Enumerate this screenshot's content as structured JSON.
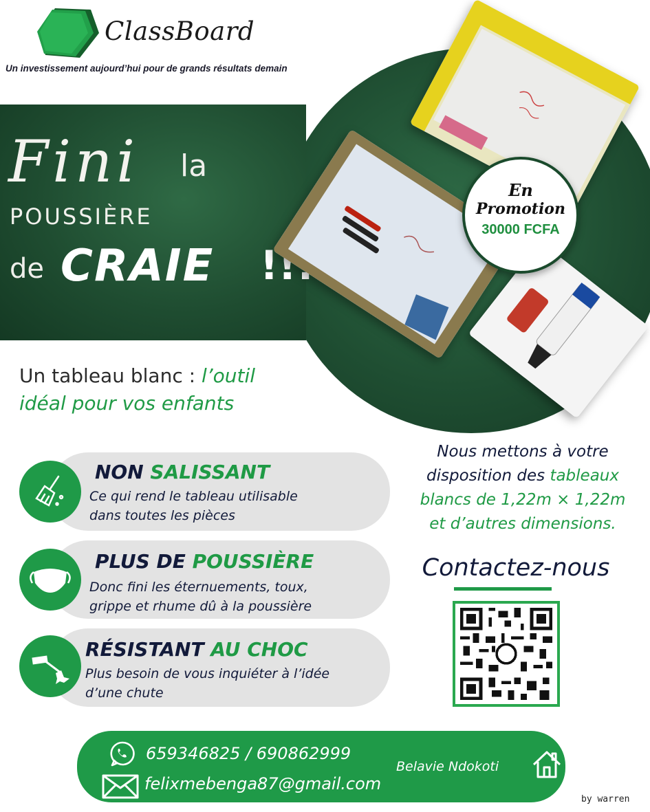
{
  "brand": {
    "name": "ClassBoard",
    "tagline": "Un investissement aujourd’hui pour de grands résultats demain",
    "color_green": "#1f9a48",
    "color_dark_green": "#1f4e32"
  },
  "headline": {
    "fini": "Fini",
    "la": "la",
    "poussiere": "POUSSIÈRE",
    "de": "de",
    "craie": "CRAIE",
    "exclaim": "!!!"
  },
  "promo": {
    "line1": "En",
    "line2": "Promotion",
    "price": "30000 FCFA"
  },
  "subtitle": {
    "part1": "Un tableau blanc : ",
    "part2": "l’outil",
    "line2": "idéal pour vos enfants"
  },
  "features": [
    {
      "title_dark": "NON ",
      "title_green": "SALISSANT",
      "desc1": "Ce qui rend le tableau utilisable",
      "desc2": "dans toutes les pièces",
      "icon": "broom-icon"
    },
    {
      "title_dark": "PLUS DE ",
      "title_green": "POUSSIÈRE",
      "desc1": "Donc fini les éternuements, toux,",
      "desc2": "grippe et rhume dû à la poussière",
      "icon": "mask-icon"
    },
    {
      "title_dark": "RÉSISTANT ",
      "title_green": "AU CHOC",
      "desc1": "Plus besoin de vous inquiéter à l’idée",
      "desc2": "d’une chute",
      "icon": "hammer-icon"
    }
  ],
  "info": {
    "l1": "Nous mettons à votre",
    "l2a": "disposition des ",
    "l2b": "tableaux",
    "l3": "blancs de 1,22m × 1,22m",
    "l4": "et d’autres dimensions."
  },
  "contact": {
    "title": "Contactez-nous",
    "phone": "659346825 / 690862999",
    "email": "felixmebenga87@gmail.com",
    "address": "Belavie Ndokoti"
  },
  "credit": "by warren"
}
